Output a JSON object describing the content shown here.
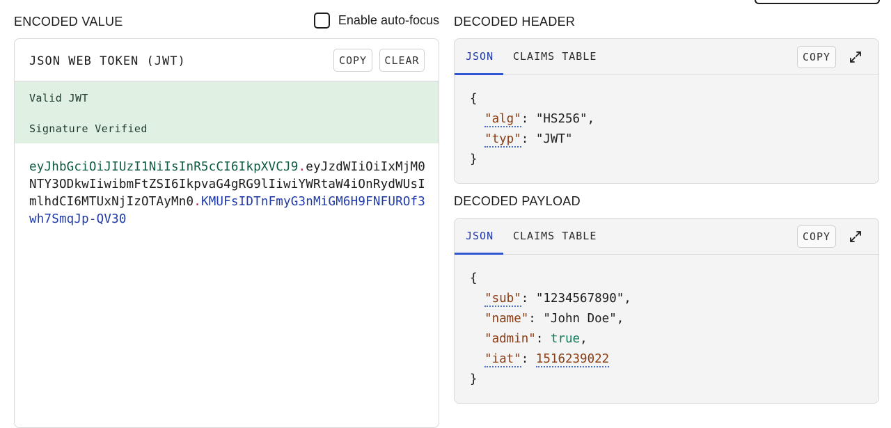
{
  "encoded": {
    "section_title": "ENCODED VALUE",
    "autofocus_label": "Enable auto-focus",
    "card_heading": "JSON WEB TOKEN (JWT)",
    "copy_label": "COPY",
    "clear_label": "CLEAR",
    "status_valid": "Valid JWT",
    "status_signature": "Signature Verified",
    "token_header": "eyJhbGciOiJIUzI1NiIsInR5cCI6IkpXVCJ9",
    "token_payload": "eyJzdWIiOiIxMjM0NTY3ODkwIiwibmFtZSI6IkpvaG4gRG9lIiwiYWRtaW4iOnRydWUsImlhdCI6MTUxNjIzOTAyMn0",
    "token_signature": "KMUFsIDTnFmyG3nMiGM6H9FNFUROf3wh7SmqJp-QV30",
    "dot": "."
  },
  "decoded_header": {
    "section_title": "DECODED HEADER",
    "tab_json": "JSON",
    "tab_claims": "CLAIMS TABLE",
    "copy_label": "COPY",
    "open_brace": "{",
    "close_brace": "}",
    "alg_key": "\"alg\"",
    "alg_value": "\"HS256\"",
    "typ_key": "\"typ\"",
    "typ_value": "\"JWT\""
  },
  "decoded_payload": {
    "section_title": "DECODED PAYLOAD",
    "tab_json": "JSON",
    "tab_claims": "CLAIMS TABLE",
    "copy_label": "COPY",
    "open_brace": "{",
    "close_brace": "}",
    "sub_key": "\"sub\"",
    "sub_value": "\"1234567890\"",
    "name_key": "\"name\"",
    "name_value": "\"John Doe\"",
    "admin_key": "\"admin\"",
    "admin_value": "true",
    "iat_key": "\"iat\"",
    "iat_value": "1516239022"
  },
  "colors": {
    "status_bg": "#e0f1e4",
    "token_header": "#0d5940",
    "token_signature": "#1f3aa8",
    "json_key": "#8a3b12",
    "json_bool": "#137a5b",
    "tab_active": "#2f55d4"
  },
  "icons": {
    "expand": "expand-icon",
    "checkbox": "checkbox-icon"
  }
}
